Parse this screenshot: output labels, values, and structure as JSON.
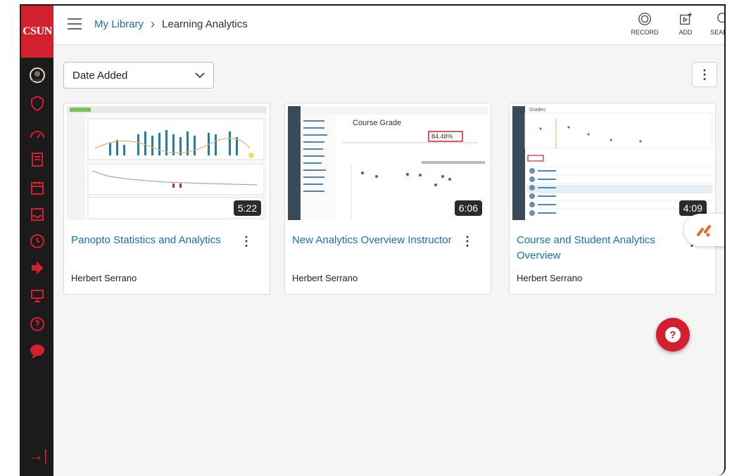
{
  "brand": {
    "logo_text": "CSUN",
    "accent": "#d2202f",
    "sidebar_bg": "#1b1b1b",
    "link_color": "#1473a8"
  },
  "breadcrumb": {
    "root": "My Library",
    "current": "Learning Analytics"
  },
  "actions": [
    {
      "label": "RECORD",
      "icon": "record-icon"
    },
    {
      "label": "ADD",
      "icon": "add-media-icon"
    },
    {
      "label": "SEARCH",
      "icon": "search-icon"
    }
  ],
  "sort": {
    "selected": "Date Added"
  },
  "sidebar_icons": [
    "avatar",
    "shield-icon",
    "dashboard-icon",
    "courses-icon",
    "calendar-icon",
    "inbox-icon",
    "history-icon",
    "logout-icon",
    "studio-icon",
    "help-icon",
    "chat-icon"
  ],
  "videos": [
    {
      "title": "Panopto Statistics and Analytics",
      "author": "Herbert Serrano",
      "duration": "5:22"
    },
    {
      "title": "New Analytics Overview Instructor",
      "author": "Herbert Serrano",
      "duration": "6:06"
    },
    {
      "title": "Course and Student Analytics Overview",
      "author": "Herbert Serrano",
      "duration": "4:09"
    }
  ],
  "thumb_text": {
    "course_grade": "Course Grade",
    "grade_pct": "84.48%",
    "grades": "Grades"
  }
}
